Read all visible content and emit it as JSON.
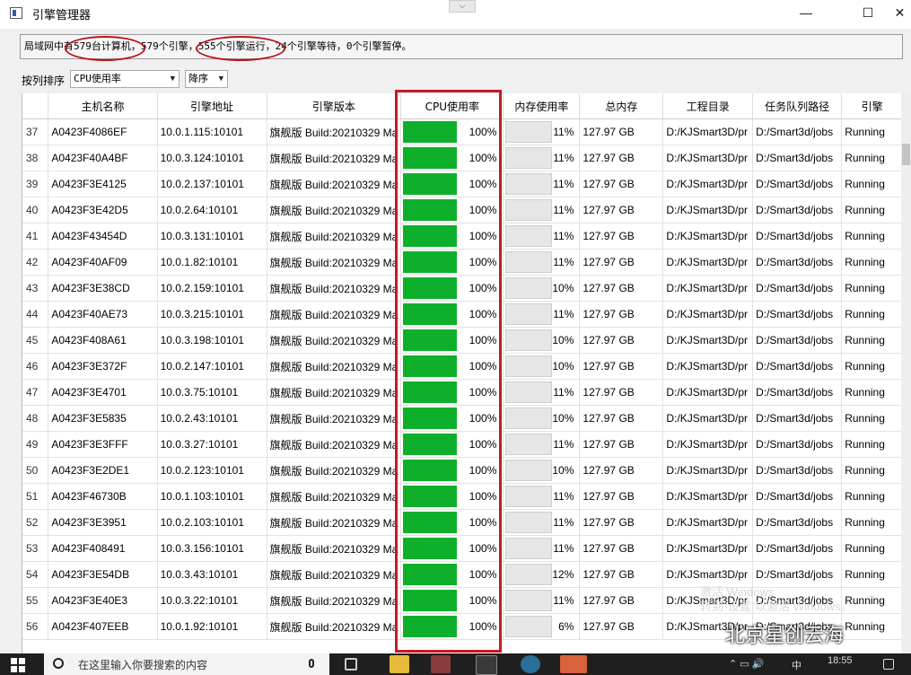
{
  "window": {
    "title": "引擎管理器",
    "collapse_glyph": "⌵",
    "minimize_glyph": "—",
    "maximize_glyph": "☐",
    "close_glyph": "✕"
  },
  "status": {
    "part1": "局域网中",
    "part2": "有579台计算机",
    "part3": "，579个引擎，",
    "part4": "555个引擎运行",
    "part5": "，24个引擎等待，0个引擎暂停。"
  },
  "sort": {
    "label": "按列排序",
    "column_value": "CPU使用率",
    "order_value": "降序"
  },
  "columns": [
    "",
    "主机名称",
    "引擎地址",
    "引擎版本",
    "CPU使用率",
    "内存使用率",
    "总内存",
    "工程目录",
    "任务队列路径",
    "引擎"
  ],
  "rows": [
    {
      "n": "37",
      "host": "A0423F4086EF",
      "addr": "10.0.1.115:10101",
      "ver": "旗舰版 Build:20210329",
      "ver_extra": "Ma",
      "cpu": "100%",
      "mem": "11%",
      "total": "127.97 GB",
      "proj": "D:/KJSmart3D/pr",
      "queue": "D:/Smart3d/jobs",
      "state": "Running"
    },
    {
      "n": "38",
      "host": "A0423F40A4BF",
      "addr": "10.0.3.124:10101",
      "ver": "旗舰版 Build:20210329",
      "ver_extra": "Ma",
      "cpu": "100%",
      "mem": "11%",
      "total": "127.97 GB",
      "proj": "D:/KJSmart3D/pr",
      "queue": "D:/Smart3d/jobs",
      "state": "Running"
    },
    {
      "n": "39",
      "host": "A0423F3E4125",
      "addr": "10.0.2.137:10101",
      "ver": "旗舰版 Build:20210329",
      "ver_extra": "Ma",
      "cpu": "100%",
      "mem": "11%",
      "total": "127.97 GB",
      "proj": "D:/KJSmart3D/pr",
      "queue": "D:/Smart3d/jobs",
      "state": "Running"
    },
    {
      "n": "40",
      "host": "A0423F3E42D5",
      "addr": "10.0.2.64:10101",
      "ver": "旗舰版 Build:20210329",
      "ver_extra": "Ma",
      "cpu": "100%",
      "mem": "11%",
      "total": "127.97 GB",
      "proj": "D:/KJSmart3D/pr",
      "queue": "D:/Smart3d/jobs",
      "state": "Running"
    },
    {
      "n": "41",
      "host": "A0423F43454D",
      "addr": "10.0.3.131:10101",
      "ver": "旗舰版 Build:20210329",
      "ver_extra": "Ma",
      "cpu": "100%",
      "mem": "11%",
      "total": "127.97 GB",
      "proj": "D:/KJSmart3D/pr",
      "queue": "D:/Smart3d/jobs",
      "state": "Running"
    },
    {
      "n": "42",
      "host": "A0423F40AF09",
      "addr": "10.0.1.82:10101",
      "ver": "旗舰版 Build:20210329",
      "ver_extra": "Ma",
      "cpu": "100%",
      "mem": "11%",
      "total": "127.97 GB",
      "proj": "D:/KJSmart3D/pr",
      "queue": "D:/Smart3d/jobs",
      "state": "Running"
    },
    {
      "n": "43",
      "host": "A0423F3E38CD",
      "addr": "10.0.2.159:10101",
      "ver": "旗舰版 Build:20210329",
      "ver_extra": "Ma",
      "cpu": "100%",
      "mem": "10%",
      "total": "127.97 GB",
      "proj": "D:/KJSmart3D/pr",
      "queue": "D:/Smart3d/jobs",
      "state": "Running"
    },
    {
      "n": "44",
      "host": "A0423F40AE73",
      "addr": "10.0.3.215:10101",
      "ver": "旗舰版 Build:20210329",
      "ver_extra": "Ma",
      "cpu": "100%",
      "mem": "11%",
      "total": "127.97 GB",
      "proj": "D:/KJSmart3D/pr",
      "queue": "D:/Smart3d/jobs",
      "state": "Running"
    },
    {
      "n": "45",
      "host": "A0423F408A61",
      "addr": "10.0.3.198:10101",
      "ver": "旗舰版 Build:20210329",
      "ver_extra": "Ma",
      "cpu": "100%",
      "mem": "10%",
      "total": "127.97 GB",
      "proj": "D:/KJSmart3D/pr",
      "queue": "D:/Smart3d/jobs",
      "state": "Running"
    },
    {
      "n": "46",
      "host": "A0423F3E372F",
      "addr": "10.0.2.147:10101",
      "ver": "旗舰版 Build:20210329",
      "ver_extra": "Ma",
      "cpu": "100%",
      "mem": "10%",
      "total": "127.97 GB",
      "proj": "D:/KJSmart3D/pr",
      "queue": "D:/Smart3d/jobs",
      "state": "Running"
    },
    {
      "n": "47",
      "host": "A0423F3E4701",
      "addr": "10.0.3.75:10101",
      "ver": "旗舰版 Build:20210329",
      "ver_extra": "Ma",
      "cpu": "100%",
      "mem": "11%",
      "total": "127.97 GB",
      "proj": "D:/KJSmart3D/pr",
      "queue": "D:/Smart3d/jobs",
      "state": "Running"
    },
    {
      "n": "48",
      "host": "A0423F3E5835",
      "addr": "10.0.2.43:10101",
      "ver": "旗舰版 Build:20210329",
      "ver_extra": "Ma",
      "cpu": "100%",
      "mem": "10%",
      "total": "127.97 GB",
      "proj": "D:/KJSmart3D/pr",
      "queue": "D:/Smart3d/jobs",
      "state": "Running"
    },
    {
      "n": "49",
      "host": "A0423F3E3FFF",
      "addr": "10.0.3.27:10101",
      "ver": "旗舰版 Build:20210329",
      "ver_extra": "Ma",
      "cpu": "100%",
      "mem": "11%",
      "total": "127.97 GB",
      "proj": "D:/KJSmart3D/pr",
      "queue": "D:/Smart3d/jobs",
      "state": "Running"
    },
    {
      "n": "50",
      "host": "A0423F3E2DE1",
      "addr": "10.0.2.123:10101",
      "ver": "旗舰版 Build:20210329",
      "ver_extra": "Ma",
      "cpu": "100%",
      "mem": "10%",
      "total": "127.97 GB",
      "proj": "D:/KJSmart3D/pr",
      "queue": "D:/Smart3d/jobs",
      "state": "Running"
    },
    {
      "n": "51",
      "host": "A0423F46730B",
      "addr": "10.0.1.103:10101",
      "ver": "旗舰版 Build:20210329",
      "ver_extra": "Ma",
      "cpu": "100%",
      "mem": "11%",
      "total": "127.97 GB",
      "proj": "D:/KJSmart3D/pr",
      "queue": "D:/Smart3d/jobs",
      "state": "Running"
    },
    {
      "n": "52",
      "host": "A0423F3E3951",
      "addr": "10.0.2.103:10101",
      "ver": "旗舰版 Build:20210329",
      "ver_extra": "Ma",
      "cpu": "100%",
      "mem": "11%",
      "total": "127.97 GB",
      "proj": "D:/KJSmart3D/pr",
      "queue": "D:/Smart3d/jobs",
      "state": "Running"
    },
    {
      "n": "53",
      "host": "A0423F408491",
      "addr": "10.0.3.156:10101",
      "ver": "旗舰版 Build:20210329",
      "ver_extra": "Ma",
      "cpu": "100%",
      "mem": "11%",
      "total": "127.97 GB",
      "proj": "D:/KJSmart3D/pr",
      "queue": "D:/Smart3d/jobs",
      "state": "Running"
    },
    {
      "n": "54",
      "host": "A0423F3E54DB",
      "addr": "10.0.3.43:10101",
      "ver": "旗舰版 Build:20210329",
      "ver_extra": "Ma",
      "cpu": "100%",
      "mem": "12%",
      "total": "127.97 GB",
      "proj": "D:/KJSmart3D/pr",
      "queue": "D:/Smart3d/jobs",
      "state": "Running"
    },
    {
      "n": "55",
      "host": "A0423F3E40E3",
      "addr": "10.0.3.22:10101",
      "ver": "旗舰版 Build:20210329",
      "ver_extra": "Ma",
      "cpu": "100%",
      "mem": "11%",
      "total": "127.97 GB",
      "proj": "D:/KJSmart3D/pr",
      "queue": "D:/Smart3d/jobs",
      "state": "Running"
    },
    {
      "n": "56",
      "host": "A0423F407EEB",
      "addr": "10.0.1.92:10101",
      "ver": "旗舰版 Build:20210329",
      "ver_extra": "Ma",
      "cpu": "100%",
      "mem": "6%",
      "total": "127.97 GB",
      "proj": "D:/KJSmart3D/pr",
      "queue": "D:/Smart3d/jobs",
      "state": "Running"
    }
  ],
  "colors": {
    "cpu_fill": "#0eb02b",
    "annotation_red": "#c41a22"
  },
  "taskbar": {
    "search_placeholder": "在这里输入你要搜索的内容",
    "tray_lang": "中",
    "clock_time": "18:55",
    "tray_glyphs": "⌃ ▭ 🔊"
  },
  "watermark": {
    "line1": "激活 Windows",
    "line2": "转到\"设置\"以激活 Windows。",
    "brand": "北京星创云海"
  }
}
